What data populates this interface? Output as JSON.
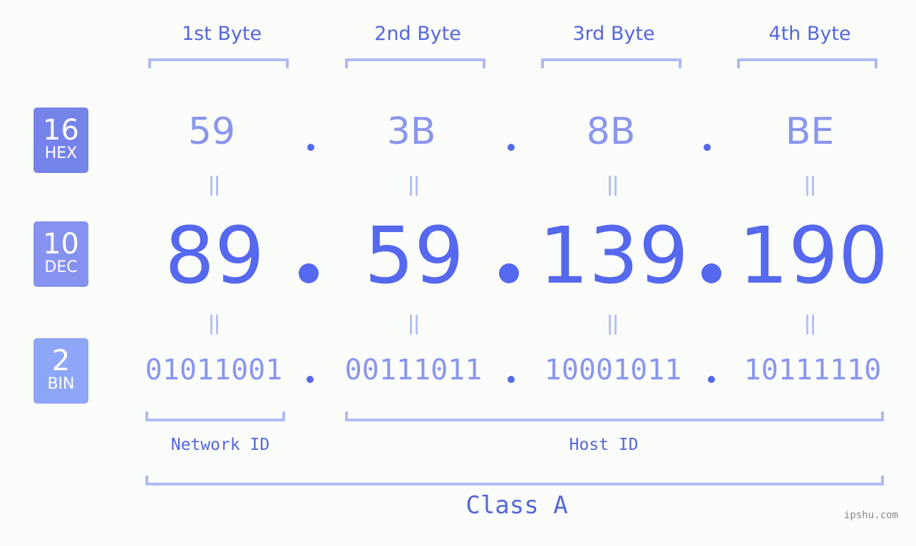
{
  "byte_headers": [
    "1st Byte",
    "2nd Byte",
    "3rd Byte",
    "4th Byte"
  ],
  "badges": {
    "hex": {
      "num": "16",
      "label": "HEX",
      "color": "#7683ea"
    },
    "dec": {
      "num": "10",
      "label": "DEC",
      "color": "#8592ef"
    },
    "bin": {
      "num": "2",
      "label": "BIN",
      "color": "#8ea6f7"
    }
  },
  "hex": [
    "59",
    "3B",
    "8B",
    "BE"
  ],
  "dec": [
    "89",
    "59",
    "139",
    "190"
  ],
  "bin": [
    "01011001",
    "00111011",
    "10001011",
    "10111110"
  ],
  "labels": {
    "network_id": "Network ID",
    "host_id": "Host ID",
    "class": "Class A"
  },
  "watermark": "ipshu.com"
}
